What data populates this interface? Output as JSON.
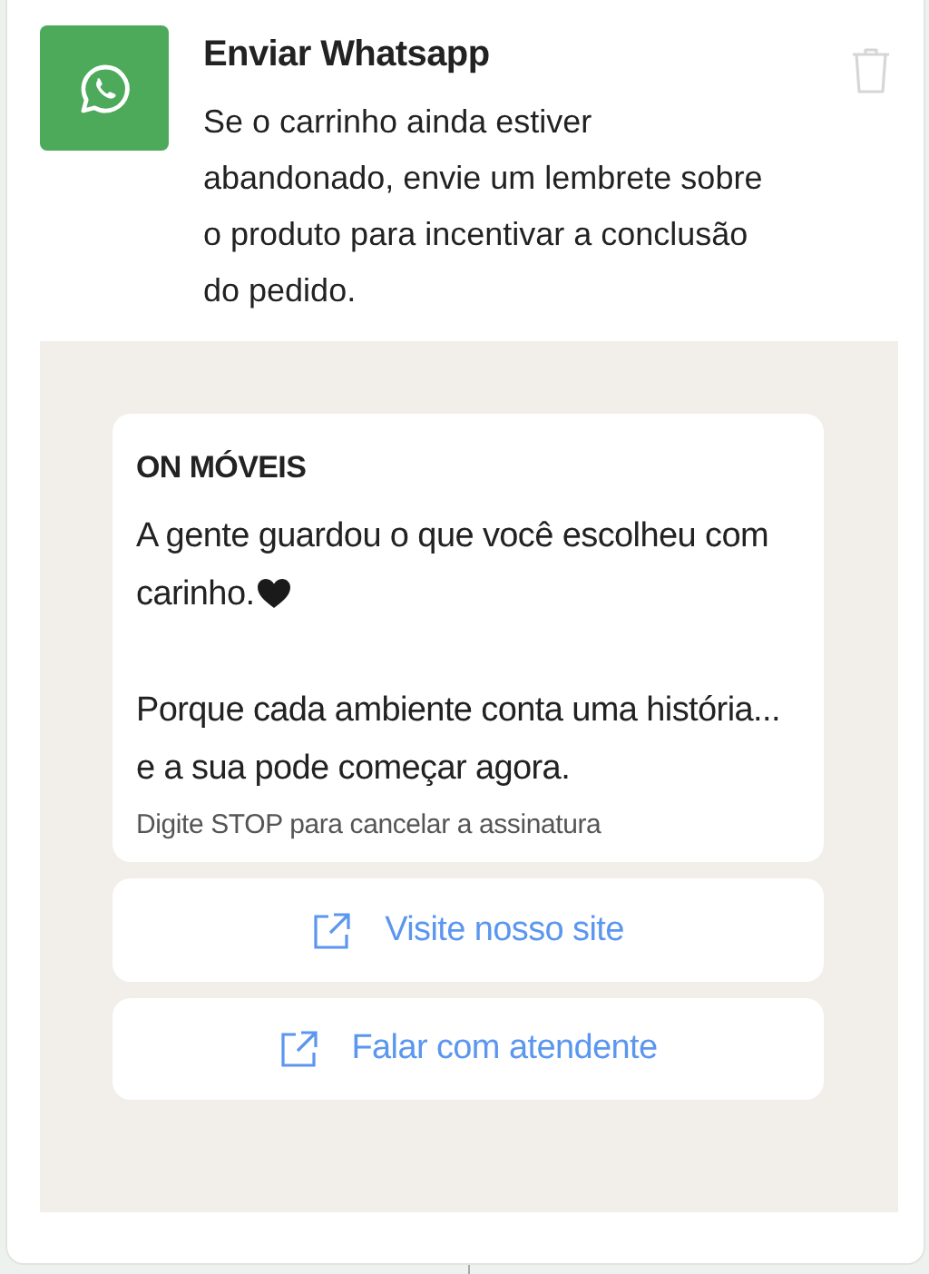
{
  "step": {
    "title": "Enviar Whatsapp",
    "description": "Se o carrinho ainda estiver abandonado, envie um lembrete sobre o produto para incentivar a conclusão do pedido."
  },
  "preview": {
    "sender": "ON MÓVEIS",
    "paragraphs": [
      {
        "text": "A gente guardou o que você escolheu com carinho.",
        "heart": true
      },
      {
        "text": "Porque cada ambiente conta uma história... e a sua pode começar agora.",
        "heart": false
      }
    ],
    "footer": "Digite STOP para cancelar a assinatura",
    "buttons": [
      {
        "label": "Visite nosso site"
      },
      {
        "label": "Falar com atendente"
      }
    ]
  }
}
